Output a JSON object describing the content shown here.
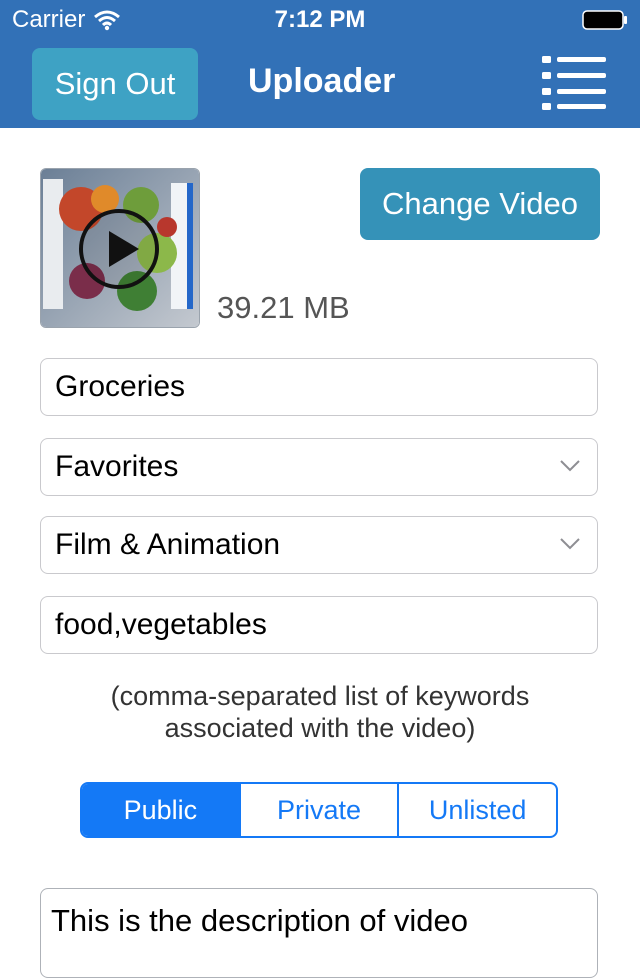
{
  "status_bar": {
    "carrier": "Carrier",
    "time": "7:12 PM"
  },
  "nav": {
    "sign_out_label": "Sign Out",
    "title": "Uploader",
    "menu_icon": "hamburger-list-icon"
  },
  "video": {
    "thumbnail_icon": "play-icon",
    "file_size": "39.21 MB",
    "change_label": "Change Video"
  },
  "form": {
    "title_value": "Groceries",
    "playlist_value": "Favorites",
    "category_value": "Film & Animation",
    "keywords_value": "food,vegetables",
    "keywords_hint_line1": "(comma-separated list of keywords",
    "keywords_hint_line2": "associated with the video)"
  },
  "privacy": {
    "options": [
      "Public",
      "Private",
      "Unlisted"
    ],
    "selected": "Public"
  },
  "description": {
    "value": "This is the description of video"
  },
  "colors": {
    "nav_bar": "#3271b7",
    "sign_out_button": "#3ea2c4",
    "change_video_button": "#3592b8",
    "segment_accent": "#1479f6"
  }
}
